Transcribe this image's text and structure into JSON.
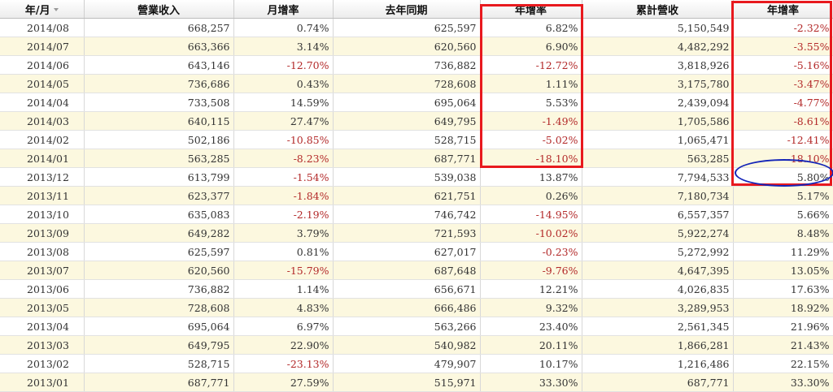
{
  "columns": [
    {
      "key": "date",
      "label": "年/月"
    },
    {
      "key": "revenue",
      "label": "營業收入"
    },
    {
      "key": "mom",
      "label": "月增率"
    },
    {
      "key": "prev_year",
      "label": "去年同期"
    },
    {
      "key": "yoy",
      "label": "年增率"
    },
    {
      "key": "cumulative",
      "label": "累計營收"
    },
    {
      "key": "cum_yoy",
      "label": "年增率"
    }
  ],
  "colors": {
    "negative_text": "#b32a2a",
    "highlight_box": "#e8191e",
    "highlight_ellipse": "#1425b8",
    "stripe": "#fcf8df"
  },
  "rows": [
    [
      "2014/08",
      "668,257",
      "0.74%",
      "625,597",
      "6.82%",
      "5,150,549",
      "-2.32%"
    ],
    [
      "2014/07",
      "663,366",
      "3.14%",
      "620,560",
      "6.90%",
      "4,482,292",
      "-3.55%"
    ],
    [
      "2014/06",
      "643,146",
      "-12.70%",
      "736,882",
      "-12.72%",
      "3,818,926",
      "-5.16%"
    ],
    [
      "2014/05",
      "736,686",
      "0.43%",
      "728,608",
      "1.11%",
      "3,175,780",
      "-3.47%"
    ],
    [
      "2014/04",
      "733,508",
      "14.59%",
      "695,064",
      "5.53%",
      "2,439,094",
      "-4.77%"
    ],
    [
      "2014/03",
      "640,115",
      "27.47%",
      "649,795",
      "-1.49%",
      "1,705,586",
      "-8.61%"
    ],
    [
      "2014/02",
      "502,186",
      "-10.85%",
      "528,715",
      "-5.02%",
      "1,065,471",
      "-12.41%"
    ],
    [
      "2014/01",
      "563,285",
      "-8.23%",
      "687,771",
      "-18.10%",
      "563,285",
      "-18.10%"
    ],
    [
      "2013/12",
      "613,799",
      "-1.54%",
      "539,038",
      "13.87%",
      "7,794,533",
      "5.80%"
    ],
    [
      "2013/11",
      "623,377",
      "-1.84%",
      "621,751",
      "0.26%",
      "7,180,734",
      "5.17%"
    ],
    [
      "2013/10",
      "635,083",
      "-2.19%",
      "746,742",
      "-14.95%",
      "6,557,357",
      "5.66%"
    ],
    [
      "2013/09",
      "649,282",
      "3.79%",
      "721,593",
      "-10.02%",
      "5,922,274",
      "8.48%"
    ],
    [
      "2013/08",
      "625,597",
      "0.81%",
      "627,017",
      "-0.23%",
      "5,272,992",
      "11.29%"
    ],
    [
      "2013/07",
      "620,560",
      "-15.79%",
      "687,648",
      "-9.76%",
      "4,647,395",
      "13.05%"
    ],
    [
      "2013/06",
      "736,882",
      "1.14%",
      "656,671",
      "12.21%",
      "4,026,835",
      "17.63%"
    ],
    [
      "2013/05",
      "728,608",
      "4.83%",
      "666,486",
      "9.32%",
      "3,289,953",
      "18.92%"
    ],
    [
      "2013/04",
      "695,064",
      "6.97%",
      "563,266",
      "23.40%",
      "2,561,345",
      "21.96%"
    ],
    [
      "2013/03",
      "649,795",
      "22.90%",
      "540,982",
      "20.11%",
      "1,866,281",
      "21.43%"
    ],
    [
      "2013/02",
      "528,715",
      "-23.13%",
      "479,907",
      "10.17%",
      "1,216,486",
      "22.15%"
    ],
    [
      "2013/01",
      "687,771",
      "27.59%",
      "515,971",
      "33.30%",
      "687,771",
      "33.30%"
    ]
  ]
}
